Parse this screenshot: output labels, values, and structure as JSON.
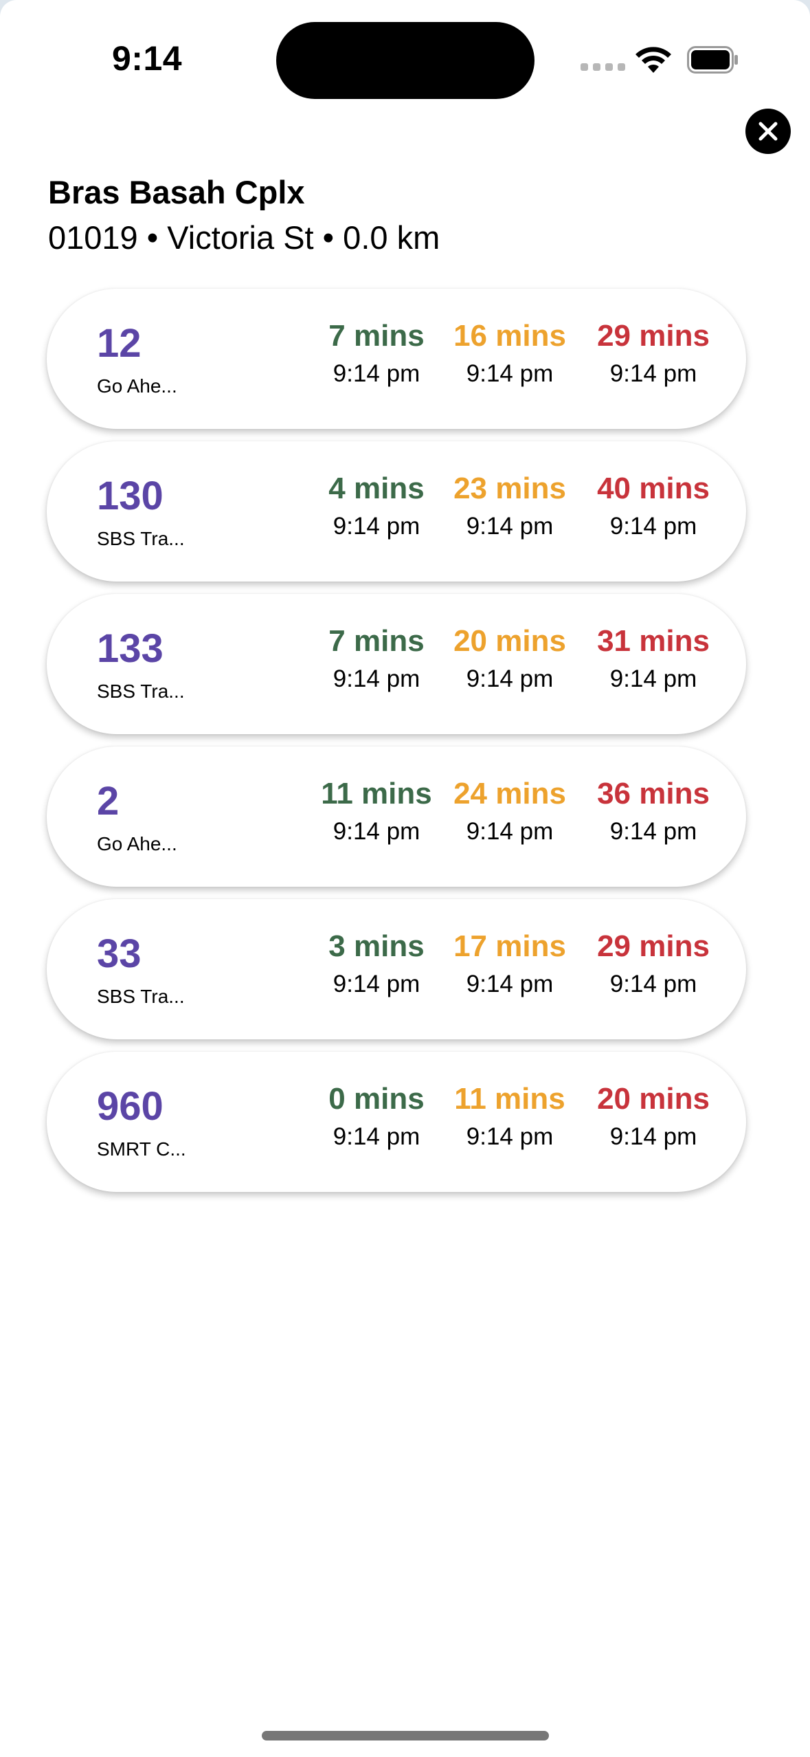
{
  "status_bar": {
    "time": "9:14"
  },
  "header": {
    "stop_name": "Bras Basah Cplx",
    "stop_meta": "01019 • Victoria St • 0.0 km"
  },
  "colors": {
    "service": "#5b45a6",
    "first": "#3c6a49",
    "second": "#eda22d",
    "third": "#c8333b"
  },
  "services": [
    {
      "number": "12",
      "operator": "Go Ahe...",
      "arrivals": [
        {
          "mins": "7 mins",
          "time": "9:14 pm"
        },
        {
          "mins": "16 mins",
          "time": "9:14 pm"
        },
        {
          "mins": "29 mins",
          "time": "9:14 pm"
        }
      ]
    },
    {
      "number": "130",
      "operator": "SBS Tra...",
      "arrivals": [
        {
          "mins": "4 mins",
          "time": "9:14 pm"
        },
        {
          "mins": "23 mins",
          "time": "9:14 pm"
        },
        {
          "mins": "40 mins",
          "time": "9:14 pm"
        }
      ]
    },
    {
      "number": "133",
      "operator": "SBS Tra...",
      "arrivals": [
        {
          "mins": "7 mins",
          "time": "9:14 pm"
        },
        {
          "mins": "20 mins",
          "time": "9:14 pm"
        },
        {
          "mins": "31 mins",
          "time": "9:14 pm"
        }
      ]
    },
    {
      "number": "2",
      "operator": "Go Ahe...",
      "arrivals": [
        {
          "mins": "11 mins",
          "time": "9:14 pm"
        },
        {
          "mins": "24 mins",
          "time": "9:14 pm"
        },
        {
          "mins": "36 mins",
          "time": "9:14 pm"
        }
      ]
    },
    {
      "number": "33",
      "operator": "SBS Tra...",
      "arrivals": [
        {
          "mins": "3 mins",
          "time": "9:14 pm"
        },
        {
          "mins": "17 mins",
          "time": "9:14 pm"
        },
        {
          "mins": "29 mins",
          "time": "9:14 pm"
        }
      ]
    },
    {
      "number": "960",
      "operator": "SMRT C...",
      "arrivals": [
        {
          "mins": "0 mins",
          "time": "9:14 pm"
        },
        {
          "mins": "11 mins",
          "time": "9:14 pm"
        },
        {
          "mins": "20 mins",
          "time": "9:14 pm"
        }
      ]
    }
  ]
}
